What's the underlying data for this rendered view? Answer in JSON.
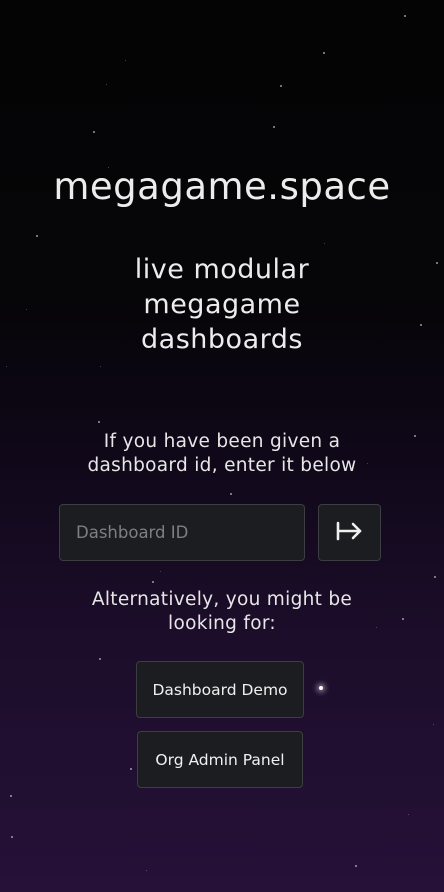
{
  "header": {
    "site_title": "megagame.space",
    "tagline_lines": [
      "live modular",
      "megagame",
      "dashboards"
    ]
  },
  "entry": {
    "instruction_lines": [
      "If you have been given a",
      "dashboard id, enter it below"
    ],
    "input_value": "",
    "input_placeholder": "Dashboard ID",
    "submit_icon": "arrow-right-to-bar-icon"
  },
  "alternatives": {
    "text_lines": [
      "Alternatively, you might be",
      "looking for:"
    ],
    "demo_label": "Dashboard Demo",
    "admin_label": "Org Admin Panel"
  },
  "colors": {
    "background_top": "#040404",
    "background_bottom": "#261138",
    "button_bg": "#1c1d21",
    "button_border": "#3c3e44",
    "text": "#e6e6e6",
    "placeholder": "#7d7f86"
  }
}
